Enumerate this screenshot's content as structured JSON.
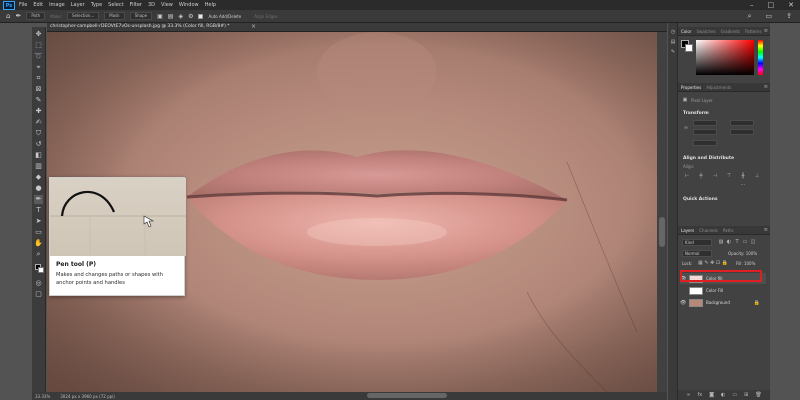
{
  "menubar": {
    "logo": "Ps",
    "items": [
      "File",
      "Edit",
      "Image",
      "Layer",
      "Type",
      "Select",
      "Filter",
      "3D",
      "View",
      "Window",
      "Help"
    ],
    "window_controls": [
      "–",
      "□",
      "✕"
    ]
  },
  "options_bar": {
    "mode": "Path",
    "make": "Make:",
    "buttons": [
      "Selection...",
      "Mask",
      "Shape"
    ],
    "auto_add_delete": "Auto Add/Delete",
    "align_edges": "Align Edges"
  },
  "document": {
    "tab_title": "christopher-campbell-rDEOVtE7vOs-unsplash.jpg @ 33.3% (Color fill, RGB/8#) *",
    "zoom": "33.33%",
    "doc_info": "3024 px x 3960 px (72 ppi)"
  },
  "tooltip": {
    "title": "Pen tool (P)",
    "description": "Makes and changes paths or shapes with anchor points and handles"
  },
  "panels": {
    "color_tabs": [
      "Color",
      "Swatches",
      "Gradients",
      "Patterns"
    ],
    "properties_tabs": [
      "Properties",
      "Adjustments"
    ],
    "pixel_layer": "Pixel Layer",
    "transform": "Transform",
    "align_distribute": "Align and Distribute",
    "align": "Align:",
    "quick_actions": "Quick Actions",
    "layers_tabs": [
      "Layers",
      "Channels",
      "Paths"
    ],
    "kind": "Kind",
    "blend_mode": "Normal",
    "opacity": "Opacity: 100%",
    "lock": "Lock:",
    "fill": "Fill: 100%"
  },
  "layers": [
    {
      "name": "Color fill",
      "visible": true,
      "selected": true,
      "thumb_color": "#f4d8d8"
    },
    {
      "name": "Color Fill",
      "visible": false,
      "selected": false,
      "thumb_color": "#ffffff"
    },
    {
      "name": "Background",
      "visible": true,
      "selected": false,
      "thumb_color": "#b58878",
      "locked": true
    }
  ],
  "colors": {
    "selection_highlight": "#e02020",
    "app_dark": "#2b2b2b",
    "panel_bg": "#424242"
  }
}
